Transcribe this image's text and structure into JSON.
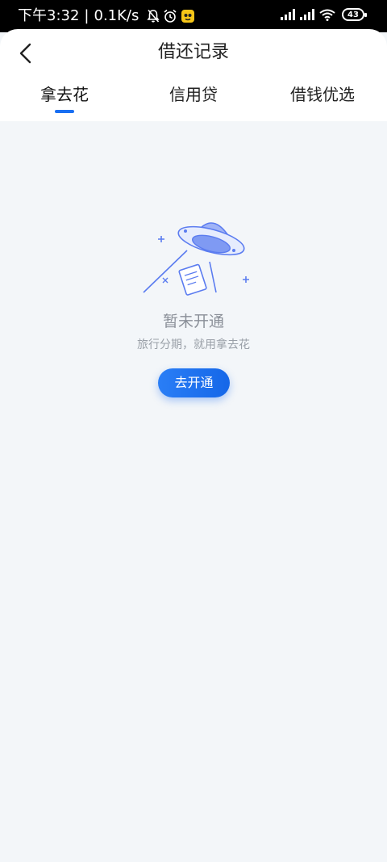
{
  "status_bar": {
    "time": "下午3:32",
    "separator": "|",
    "net_speed": "0.1K/s",
    "battery": "43"
  },
  "header": {
    "title": "借还记录"
  },
  "tabs": [
    {
      "label": "拿去花",
      "active": true
    },
    {
      "label": "信用贷",
      "active": false
    },
    {
      "label": "借钱优选",
      "active": false
    }
  ],
  "empty_state": {
    "title": "暂未开通",
    "subtitle": "旅行分期，就用拿去花",
    "button_label": "去开通"
  },
  "colors": {
    "accent": "#1a6ff2",
    "background": "#f3f6f9",
    "illustration": "#5b7cf0"
  }
}
